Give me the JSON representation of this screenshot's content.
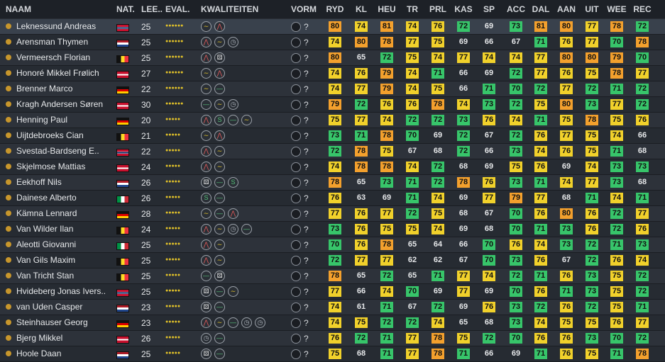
{
  "headers": {
    "naam": "NAAM",
    "nat": "NAT.",
    "lee": "LEE..",
    "eval": "EVAL.",
    "kwal": "KWALITEITEN",
    "vorm": "VORM",
    "stats": [
      "RYD",
      "KL",
      "HEU",
      "TR",
      "PRL",
      "KAS",
      "SP",
      "ACC",
      "DAL",
      "AAN",
      "UIT",
      "WEE",
      "REC"
    ]
  },
  "colors": {
    "yellow": "#f1d12b",
    "orange": "#f3a02d",
    "green": "#37c56a"
  },
  "players": [
    {
      "name": "Leknessund Andreas",
      "flag": "NO",
      "age": "25",
      "stars": "●●●●●●",
      "k": [
        "wave",
        "peak"
      ],
      "form": "?",
      "stats": [
        [
          "80",
          "o"
        ],
        [
          "74",
          "y"
        ],
        [
          "81",
          "o"
        ],
        [
          "74",
          "y"
        ],
        [
          "76",
          "y"
        ],
        [
          "72",
          "g"
        ],
        [
          "69",
          "n"
        ],
        [
          "73",
          "g"
        ],
        [
          "81",
          "o"
        ],
        [
          "80",
          "o"
        ],
        [
          "77",
          "y"
        ],
        [
          "78",
          "o"
        ],
        [
          "72",
          "g"
        ]
      ]
    },
    {
      "name": "Arensman Thymen",
      "flag": "NL",
      "age": "25",
      "stars": "●●●●●●",
      "k": [
        "peak",
        "wave",
        "clock"
      ],
      "form": "?",
      "stats": [
        [
          "74",
          "y"
        ],
        [
          "80",
          "o"
        ],
        [
          "78",
          "o"
        ],
        [
          "77",
          "y"
        ],
        [
          "75",
          "y"
        ],
        [
          "69",
          "n"
        ],
        [
          "66",
          "n"
        ],
        [
          "67",
          "n"
        ],
        [
          "71",
          "g"
        ],
        [
          "76",
          "y"
        ],
        [
          "77",
          "y"
        ],
        [
          "70",
          "g"
        ],
        [
          "78",
          "o"
        ]
      ]
    },
    {
      "name": "Vermeersch Florian",
      "flag": "BE",
      "age": "25",
      "stars": "●●●●●●",
      "k": [
        "peak",
        "dice"
      ],
      "form": "?",
      "stats": [
        [
          "80",
          "o"
        ],
        [
          "65",
          "n"
        ],
        [
          "72",
          "g"
        ],
        [
          "75",
          "y"
        ],
        [
          "74",
          "y"
        ],
        [
          "77",
          "y"
        ],
        [
          "74",
          "y"
        ],
        [
          "74",
          "y"
        ],
        [
          "77",
          "y"
        ],
        [
          "80",
          "o"
        ],
        [
          "80",
          "o"
        ],
        [
          "79",
          "o"
        ],
        [
          "70",
          "g"
        ]
      ]
    },
    {
      "name": "Honoré Mikkel Frølich",
      "flag": "DK",
      "age": "27",
      "stars": "●●●●●●",
      "k": [
        "wave",
        "peak"
      ],
      "form": "?",
      "stats": [
        [
          "74",
          "y"
        ],
        [
          "76",
          "y"
        ],
        [
          "79",
          "o"
        ],
        [
          "74",
          "y"
        ],
        [
          "71",
          "g"
        ],
        [
          "66",
          "n"
        ],
        [
          "69",
          "n"
        ],
        [
          "72",
          "g"
        ],
        [
          "77",
          "y"
        ],
        [
          "76",
          "y"
        ],
        [
          "75",
          "y"
        ],
        [
          "78",
          "o"
        ],
        [
          "77",
          "y"
        ]
      ]
    },
    {
      "name": "Brenner Marco",
      "flag": "DE",
      "age": "22",
      "stars": "●●●●●●",
      "k": [
        "wave",
        "flat"
      ],
      "form": "?",
      "stats": [
        [
          "74",
          "y"
        ],
        [
          "77",
          "y"
        ],
        [
          "79",
          "o"
        ],
        [
          "74",
          "y"
        ],
        [
          "75",
          "y"
        ],
        [
          "66",
          "n"
        ],
        [
          "71",
          "g"
        ],
        [
          "70",
          "g"
        ],
        [
          "72",
          "g"
        ],
        [
          "77",
          "y"
        ],
        [
          "72",
          "g"
        ],
        [
          "71",
          "g"
        ],
        [
          "72",
          "g"
        ]
      ]
    },
    {
      "name": "Kragh Andersen Søren",
      "flag": "DK",
      "age": "30",
      "stars": "●●●●●●",
      "k": [
        "flat",
        "wave",
        "clock"
      ],
      "form": "?",
      "stats": [
        [
          "79",
          "o"
        ],
        [
          "72",
          "g"
        ],
        [
          "76",
          "y"
        ],
        [
          "76",
          "y"
        ],
        [
          "78",
          "o"
        ],
        [
          "74",
          "y"
        ],
        [
          "73",
          "g"
        ],
        [
          "72",
          "g"
        ],
        [
          "75",
          "y"
        ],
        [
          "80",
          "o"
        ],
        [
          "73",
          "g"
        ],
        [
          "77",
          "y"
        ],
        [
          "72",
          "g"
        ]
      ]
    },
    {
      "name": "Henning Paul",
      "flag": "DE",
      "age": "20",
      "stars": "●●●●●",
      "k": [
        "peak",
        "sprint",
        "flat",
        "wave"
      ],
      "form": "?",
      "stats": [
        [
          "75",
          "y"
        ],
        [
          "77",
          "y"
        ],
        [
          "74",
          "y"
        ],
        [
          "72",
          "g"
        ],
        [
          "72",
          "g"
        ],
        [
          "73",
          "g"
        ],
        [
          "76",
          "y"
        ],
        [
          "74",
          "y"
        ],
        [
          "71",
          "g"
        ],
        [
          "75",
          "y"
        ],
        [
          "78",
          "o"
        ],
        [
          "75",
          "y"
        ],
        [
          "76",
          "y"
        ]
      ]
    },
    {
      "name": "Uijtdebroeks Cian",
      "flag": "BE",
      "age": "21",
      "stars": "●●●●●",
      "k": [
        "wave",
        "peak"
      ],
      "form": "?",
      "stats": [
        [
          "73",
          "g"
        ],
        [
          "71",
          "g"
        ],
        [
          "78",
          "o"
        ],
        [
          "70",
          "g"
        ],
        [
          "69",
          "n"
        ],
        [
          "72",
          "g"
        ],
        [
          "67",
          "n"
        ],
        [
          "72",
          "g"
        ],
        [
          "76",
          "y"
        ],
        [
          "77",
          "y"
        ],
        [
          "75",
          "y"
        ],
        [
          "74",
          "y"
        ],
        [
          "66",
          "n"
        ]
      ]
    },
    {
      "name": "Svestad-Bardseng E..",
      "flag": "NO",
      "age": "22",
      "stars": "●●●●●",
      "k": [
        "peak",
        "wave"
      ],
      "form": "?",
      "stats": [
        [
          "72",
          "g"
        ],
        [
          "78",
          "o"
        ],
        [
          "75",
          "y"
        ],
        [
          "67",
          "n"
        ],
        [
          "68",
          "n"
        ],
        [
          "72",
          "g"
        ],
        [
          "66",
          "n"
        ],
        [
          "73",
          "g"
        ],
        [
          "74",
          "y"
        ],
        [
          "76",
          "y"
        ],
        [
          "75",
          "y"
        ],
        [
          "71",
          "g"
        ],
        [
          "68",
          "n"
        ]
      ]
    },
    {
      "name": "Skjelmose Mattias",
      "flag": "DK",
      "age": "24",
      "stars": "●●●●●",
      "k": [
        "peak",
        "wave"
      ],
      "form": "?",
      "stats": [
        [
          "74",
          "y"
        ],
        [
          "78",
          "o"
        ],
        [
          "78",
          "o"
        ],
        [
          "74",
          "y"
        ],
        [
          "72",
          "g"
        ],
        [
          "68",
          "n"
        ],
        [
          "69",
          "n"
        ],
        [
          "75",
          "y"
        ],
        [
          "76",
          "y"
        ],
        [
          "69",
          "n"
        ],
        [
          "74",
          "y"
        ],
        [
          "73",
          "g"
        ],
        [
          "73",
          "g"
        ]
      ]
    },
    {
      "name": "Eekhoff Nils",
      "flag": "NL",
      "age": "26",
      "stars": "●●●●●",
      "k": [
        "dice",
        "flat",
        "sprint"
      ],
      "form": "?",
      "stats": [
        [
          "78",
          "o"
        ],
        [
          "65",
          "n"
        ],
        [
          "73",
          "g"
        ],
        [
          "71",
          "g"
        ],
        [
          "72",
          "g"
        ],
        [
          "78",
          "o"
        ],
        [
          "76",
          "y"
        ],
        [
          "73",
          "g"
        ],
        [
          "71",
          "g"
        ],
        [
          "74",
          "y"
        ],
        [
          "77",
          "y"
        ],
        [
          "73",
          "g"
        ],
        [
          "68",
          "n"
        ]
      ]
    },
    {
      "name": "Dainese Alberto",
      "flag": "IT",
      "age": "26",
      "stars": "●●●●●",
      "k": [
        "sprint",
        "flat"
      ],
      "form": "?",
      "stats": [
        [
          "76",
          "y"
        ],
        [
          "63",
          "n"
        ],
        [
          "69",
          "n"
        ],
        [
          "71",
          "g"
        ],
        [
          "74",
          "y"
        ],
        [
          "69",
          "n"
        ],
        [
          "77",
          "y"
        ],
        [
          "79",
          "o"
        ],
        [
          "77",
          "y"
        ],
        [
          "68",
          "n"
        ],
        [
          "71",
          "g"
        ],
        [
          "74",
          "y"
        ],
        [
          "71",
          "g"
        ]
      ]
    },
    {
      "name": "Kämna Lennard",
      "flag": "DE",
      "age": "28",
      "stars": "●●●●●",
      "k": [
        "wave",
        "flat",
        "peak"
      ],
      "form": "?",
      "stats": [
        [
          "77",
          "y"
        ],
        [
          "76",
          "y"
        ],
        [
          "77",
          "y"
        ],
        [
          "72",
          "g"
        ],
        [
          "75",
          "y"
        ],
        [
          "68",
          "n"
        ],
        [
          "67",
          "n"
        ],
        [
          "70",
          "g"
        ],
        [
          "76",
          "y"
        ],
        [
          "80",
          "o"
        ],
        [
          "76",
          "y"
        ],
        [
          "72",
          "g"
        ],
        [
          "77",
          "y"
        ]
      ]
    },
    {
      "name": "Van Wilder Ilan",
      "flag": "BE",
      "age": "24",
      "stars": "●●●●●",
      "k": [
        "peak",
        "wave",
        "clock",
        "flat"
      ],
      "form": "?",
      "stats": [
        [
          "73",
          "g"
        ],
        [
          "76",
          "y"
        ],
        [
          "75",
          "y"
        ],
        [
          "75",
          "y"
        ],
        [
          "74",
          "y"
        ],
        [
          "69",
          "n"
        ],
        [
          "68",
          "n"
        ],
        [
          "70",
          "g"
        ],
        [
          "71",
          "g"
        ],
        [
          "73",
          "g"
        ],
        [
          "76",
          "y"
        ],
        [
          "72",
          "g"
        ],
        [
          "76",
          "y"
        ]
      ]
    },
    {
      "name": "Aleotti Giovanni",
      "flag": "IT",
      "age": "25",
      "stars": "●●●●●",
      "k": [
        "peak",
        "wave"
      ],
      "form": "?",
      "stats": [
        [
          "70",
          "g"
        ],
        [
          "76",
          "y"
        ],
        [
          "78",
          "o"
        ],
        [
          "65",
          "n"
        ],
        [
          "64",
          "n"
        ],
        [
          "66",
          "n"
        ],
        [
          "70",
          "g"
        ],
        [
          "76",
          "y"
        ],
        [
          "74",
          "y"
        ],
        [
          "73",
          "g"
        ],
        [
          "72",
          "g"
        ],
        [
          "71",
          "g"
        ],
        [
          "73",
          "g"
        ]
      ]
    },
    {
      "name": "Van Gils Maxim",
      "flag": "BE",
      "age": "25",
      "stars": "●●●●●",
      "k": [
        "peak",
        "wave"
      ],
      "form": "?",
      "stats": [
        [
          "72",
          "g"
        ],
        [
          "77",
          "y"
        ],
        [
          "77",
          "y"
        ],
        [
          "62",
          "n"
        ],
        [
          "62",
          "n"
        ],
        [
          "67",
          "n"
        ],
        [
          "70",
          "g"
        ],
        [
          "73",
          "g"
        ],
        [
          "76",
          "y"
        ],
        [
          "67",
          "n"
        ],
        [
          "72",
          "g"
        ],
        [
          "76",
          "y"
        ],
        [
          "74",
          "y"
        ]
      ]
    },
    {
      "name": "Van Tricht Stan",
      "flag": "BE",
      "age": "25",
      "stars": "●●●●●",
      "k": [
        "flat",
        "dice"
      ],
      "form": "?",
      "stats": [
        [
          "78",
          "o"
        ],
        [
          "65",
          "n"
        ],
        [
          "72",
          "g"
        ],
        [
          "65",
          "n"
        ],
        [
          "71",
          "g"
        ],
        [
          "77",
          "y"
        ],
        [
          "74",
          "y"
        ],
        [
          "72",
          "g"
        ],
        [
          "71",
          "g"
        ],
        [
          "76",
          "y"
        ],
        [
          "73",
          "g"
        ],
        [
          "75",
          "y"
        ],
        [
          "72",
          "g"
        ]
      ]
    },
    {
      "name": "Hvideberg Jonas Ivers..",
      "flag": "NO",
      "age": "25",
      "stars": "●●●●●",
      "k": [
        "dice",
        "flat",
        "wave"
      ],
      "form": "?",
      "stats": [
        [
          "77",
          "y"
        ],
        [
          "66",
          "n"
        ],
        [
          "74",
          "y"
        ],
        [
          "70",
          "g"
        ],
        [
          "69",
          "n"
        ],
        [
          "77",
          "y"
        ],
        [
          "69",
          "n"
        ],
        [
          "70",
          "g"
        ],
        [
          "76",
          "y"
        ],
        [
          "71",
          "g"
        ],
        [
          "73",
          "g"
        ],
        [
          "75",
          "y"
        ],
        [
          "72",
          "g"
        ]
      ]
    },
    {
      "name": "van Uden Casper",
      "flag": "NL",
      "age": "23",
      "stars": "●●●●●",
      "k": [
        "dice",
        "flat"
      ],
      "form": "?",
      "stats": [
        [
          "74",
          "y"
        ],
        [
          "61",
          "n"
        ],
        [
          "71",
          "g"
        ],
        [
          "67",
          "n"
        ],
        [
          "72",
          "g"
        ],
        [
          "69",
          "n"
        ],
        [
          "76",
          "y"
        ],
        [
          "73",
          "g"
        ],
        [
          "72",
          "g"
        ],
        [
          "76",
          "y"
        ],
        [
          "72",
          "g"
        ],
        [
          "75",
          "y"
        ],
        [
          "71",
          "g"
        ]
      ]
    },
    {
      "name": "Steinhauser Georg",
      "flag": "DE",
      "age": "23",
      "stars": "●●●●●",
      "k": [
        "peak",
        "wave",
        "flat",
        "clock",
        "clock"
      ],
      "form": "?",
      "stats": [
        [
          "74",
          "y"
        ],
        [
          "75",
          "y"
        ],
        [
          "72",
          "g"
        ],
        [
          "72",
          "g"
        ],
        [
          "74",
          "y"
        ],
        [
          "65",
          "n"
        ],
        [
          "68",
          "n"
        ],
        [
          "73",
          "g"
        ],
        [
          "74",
          "y"
        ],
        [
          "75",
          "y"
        ],
        [
          "75",
          "y"
        ],
        [
          "76",
          "y"
        ],
        [
          "77",
          "y"
        ]
      ]
    },
    {
      "name": "Bjerg Mikkel",
      "flag": "DK",
      "age": "26",
      "stars": "●●●●●",
      "k": [
        "clock",
        "flat"
      ],
      "form": "?",
      "stats": [
        [
          "76",
          "y"
        ],
        [
          "72",
          "g"
        ],
        [
          "71",
          "g"
        ],
        [
          "77",
          "y"
        ],
        [
          "78",
          "o"
        ],
        [
          "75",
          "y"
        ],
        [
          "72",
          "g"
        ],
        [
          "70",
          "g"
        ],
        [
          "76",
          "y"
        ],
        [
          "76",
          "y"
        ],
        [
          "73",
          "g"
        ],
        [
          "70",
          "g"
        ],
        [
          "72",
          "g"
        ]
      ]
    },
    {
      "name": "Hoole Daan",
      "flag": "NL",
      "age": "25",
      "stars": "●●●●●",
      "k": [
        "dice",
        "flat"
      ],
      "form": "?",
      "stats": [
        [
          "75",
          "y"
        ],
        [
          "68",
          "n"
        ],
        [
          "71",
          "g"
        ],
        [
          "77",
          "y"
        ],
        [
          "78",
          "o"
        ],
        [
          "71",
          "g"
        ],
        [
          "66",
          "n"
        ],
        [
          "69",
          "n"
        ],
        [
          "71",
          "g"
        ],
        [
          "76",
          "y"
        ],
        [
          "75",
          "y"
        ],
        [
          "71",
          "g"
        ],
        [
          "78",
          "o"
        ]
      ]
    }
  ]
}
